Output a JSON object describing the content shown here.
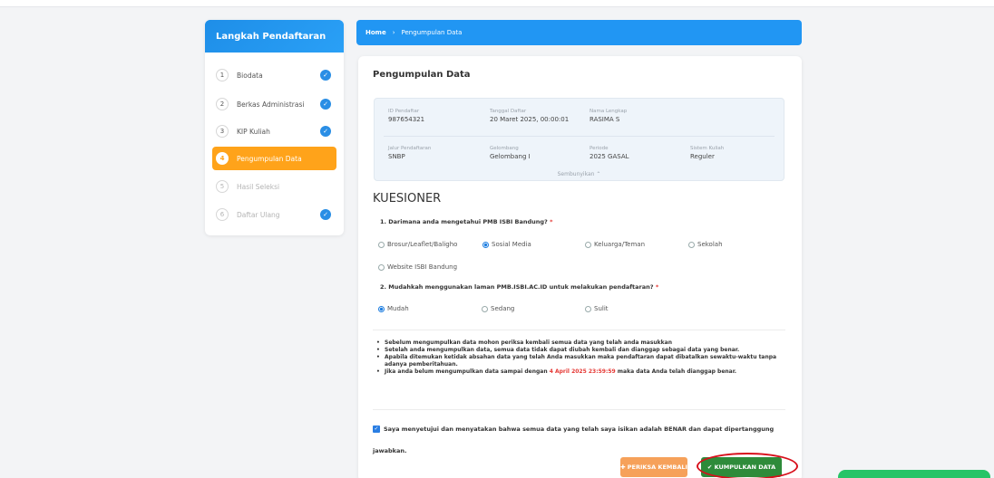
{
  "sidebar": {
    "title": "Langkah Pendaftaran",
    "steps": [
      {
        "num": "1",
        "label": "Biodata",
        "done": true
      },
      {
        "num": "2",
        "label": "Berkas Administrasi",
        "done": true
      },
      {
        "num": "3",
        "label": "KIP Kuliah",
        "done": true
      },
      {
        "num": "4",
        "label": "Pengumpulan Data",
        "done": false
      },
      {
        "num": "5",
        "label": "Hasil Seleksi",
        "done": false
      },
      {
        "num": "6",
        "label": "Daftar Ulang",
        "done": true
      }
    ]
  },
  "breadcrumb": {
    "home": "Home",
    "separator": "›",
    "current": "Pengumpulan Data"
  },
  "card": {
    "title": "Pengumpulan Data"
  },
  "info": {
    "id_label": "ID Pendaftar",
    "id_value": "987654321",
    "date_label": "Tanggal Daftar",
    "date_value": "20 Maret 2025, 00:00:01",
    "name_label": "Nama Lengkap",
    "name_value": "RASIMA S",
    "path_label": "Jalur Pendaftaran",
    "path_value": "SNBP",
    "wave_label": "Gelombang",
    "wave_value": "Gelombang I",
    "period_label": "Periode",
    "period_value": "2025 GASAL",
    "system_label": "Sistem Kuliah",
    "system_value": "Reguler",
    "hide_label": "Sembunyikan ⌃"
  },
  "questionnaire": {
    "title": "KUESIONER",
    "q1": "1. Darimana anda mengetahui PMB ISBI Bandung?",
    "q1_options": [
      "Brosur/Leaflet/Baligho",
      "Sosial Media",
      "Keluarga/Teman",
      "Sekolah",
      "Website ISBI Bandung"
    ],
    "q1_selected": "Sosial Media",
    "q2": "2. Mudahkah menggunakan laman PMB.ISBI.AC.ID untuk melakukan pendaftaran?",
    "q2_options": [
      "Mudah",
      "Sedang",
      "Sulit"
    ],
    "q2_selected": "Mudah",
    "required_mark": "*"
  },
  "notes": {
    "n1": "Sebelum mengumpulkan data mohon periksa kembali semua data yang telah anda masukkan",
    "n2": "Setelah anda mengumpulkan data, semua data tidak dapat diubah kembali dan dianggap sebagai data yang benar.",
    "n3": "Apabila ditemukan ketidak absahan data yang telah Anda masukkan maka pendaftaran dapat dibatalkan sewaktu-waktu tanpa adanya pemberitahuan.",
    "n4_pre": "Jika anda belum mengumpulkan data sampai dengan",
    "n4_deadline": "4 April 2025 23:59:59",
    "n4_post": "maka data Anda telah dianggap benar."
  },
  "agreement": {
    "text": "Saya menyetujui dan menyatakan bahwa semua data yang telah saya isikan adalah BENAR dan dapat dipertanggung jawabkan.",
    "checked": true
  },
  "buttons": {
    "check": "✚ PERIKSA KEMBALI",
    "submit": "✔ KUMPULKAN DATA"
  },
  "colors": {
    "primary": "#2196f3",
    "active_step": "#ffa31a",
    "submit": "#2e8b3a",
    "check": "#f6a15a",
    "highlight_ring": "#d80f1b"
  }
}
